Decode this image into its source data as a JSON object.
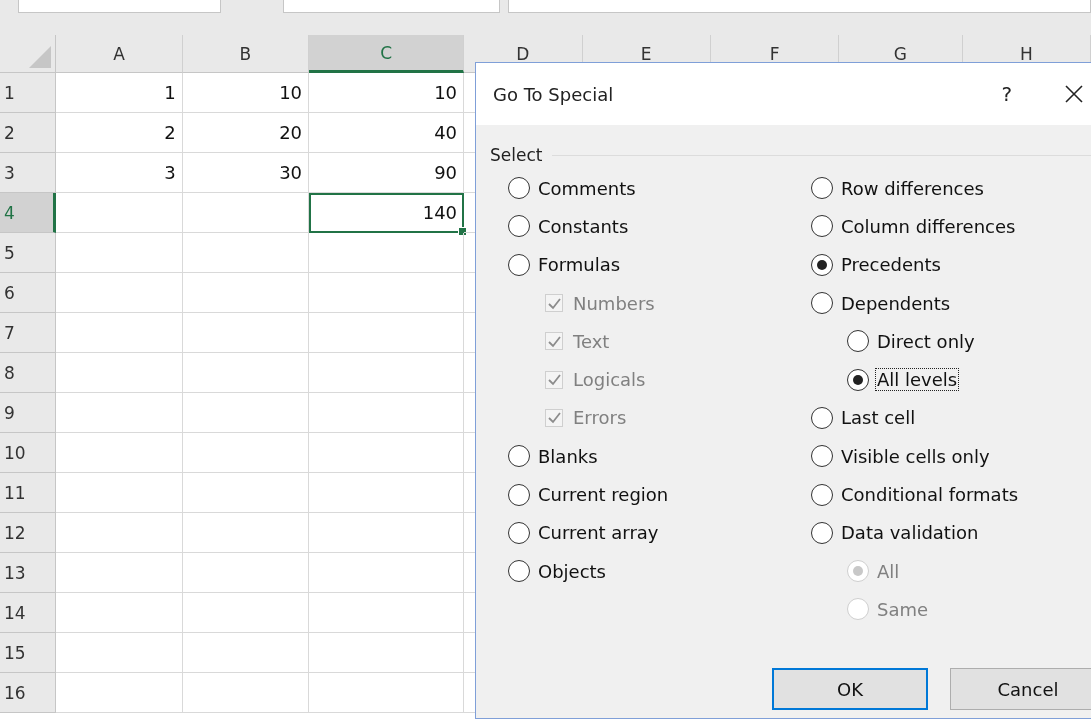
{
  "sheet": {
    "columns": [
      {
        "label": "A",
        "selected": false
      },
      {
        "label": "B",
        "selected": false
      },
      {
        "label": "C",
        "selected": true
      },
      {
        "label": "D",
        "selected": false
      },
      {
        "label": "E",
        "selected": false
      },
      {
        "label": "F",
        "selected": false
      },
      {
        "label": "G",
        "selected": false
      },
      {
        "label": "H",
        "selected": false
      }
    ],
    "rows": [
      {
        "label": "1",
        "selected": false,
        "cells": [
          {
            "value": "1",
            "active": false
          },
          {
            "value": "10",
            "active": false
          },
          {
            "value": "10",
            "active": false
          }
        ]
      },
      {
        "label": "2",
        "selected": false,
        "cells": [
          {
            "value": "2",
            "active": false
          },
          {
            "value": "20",
            "active": false
          },
          {
            "value": "40",
            "active": false
          }
        ]
      },
      {
        "label": "3",
        "selected": false,
        "cells": [
          {
            "value": "3",
            "active": false
          },
          {
            "value": "30",
            "active": false
          },
          {
            "value": "90",
            "active": false
          }
        ]
      },
      {
        "label": "4",
        "selected": true,
        "cells": [
          {
            "active": false
          },
          {
            "active": false
          },
          {
            "value": "140",
            "active": true
          }
        ]
      },
      {
        "label": "5",
        "selected": false
      },
      {
        "label": "6",
        "selected": false
      },
      {
        "label": "7",
        "selected": false
      },
      {
        "label": "8",
        "selected": false
      },
      {
        "label": "9",
        "selected": false
      },
      {
        "label": "10",
        "selected": false
      },
      {
        "label": "11",
        "selected": false
      },
      {
        "label": "12",
        "selected": false
      },
      {
        "label": "13",
        "selected": false
      },
      {
        "label": "14",
        "selected": false
      },
      {
        "label": "15",
        "selected": false
      },
      {
        "label": "16",
        "selected": false
      }
    ]
  },
  "dialog": {
    "title": "Go To Special",
    "help": "?",
    "group_label": "Select",
    "options_left": [
      {
        "kind": "radio",
        "label": "Comments",
        "selected": false,
        "disabled": false,
        "focused": false
      },
      {
        "kind": "radio",
        "label": "Constants",
        "selected": false,
        "disabled": false,
        "focused": false
      },
      {
        "kind": "radio",
        "label": "Formulas",
        "selected": false,
        "disabled": false,
        "focused": false,
        "children": [
          {
            "kind": "checkbox",
            "label": "Numbers",
            "checked": true,
            "disabled": true,
            "focused": false
          },
          {
            "kind": "checkbox",
            "label": "Text",
            "checked": true,
            "disabled": true,
            "focused": false
          },
          {
            "kind": "checkbox",
            "label": "Logicals",
            "checked": true,
            "disabled": true,
            "focused": false
          },
          {
            "kind": "checkbox",
            "label": "Errors",
            "checked": true,
            "disabled": true,
            "focused": false
          }
        ]
      },
      {
        "kind": "radio",
        "label": "Blanks",
        "selected": false,
        "disabled": false,
        "focused": false
      },
      {
        "kind": "radio",
        "label": "Current region",
        "selected": false,
        "disabled": false,
        "focused": false
      },
      {
        "kind": "radio",
        "label": "Current array",
        "selected": false,
        "disabled": false,
        "focused": false
      },
      {
        "kind": "radio",
        "label": "Objects",
        "selected": false,
        "disabled": false,
        "focused": false
      }
    ],
    "options_right": [
      {
        "kind": "radio",
        "label": "Row differences",
        "selected": false,
        "disabled": false,
        "focused": false
      },
      {
        "kind": "radio",
        "label": "Column differences",
        "selected": false,
        "disabled": false,
        "focused": false
      },
      {
        "kind": "radio",
        "label": "Precedents",
        "selected": true,
        "disabled": false,
        "focused": false
      },
      {
        "kind": "radio",
        "label": "Dependents",
        "selected": false,
        "disabled": false,
        "focused": false,
        "children": [
          {
            "kind": "radio",
            "label": "Direct only",
            "selected": false,
            "disabled": false,
            "focused": false
          },
          {
            "kind": "radio",
            "label": "All levels",
            "selected": true,
            "disabled": false,
            "focused": true
          }
        ]
      },
      {
        "kind": "radio",
        "label": "Last cell",
        "selected": false,
        "disabled": false,
        "focused": false
      },
      {
        "kind": "radio",
        "label": "Visible cells only",
        "selected": false,
        "disabled": false,
        "focused": false
      },
      {
        "kind": "radio",
        "label": "Conditional formats",
        "selected": false,
        "disabled": false,
        "focused": false
      },
      {
        "kind": "radio",
        "label": "Data validation",
        "selected": false,
        "disabled": false,
        "focused": false,
        "children": [
          {
            "kind": "radio",
            "label": "All",
            "selected": true,
            "disabled": true,
            "focused": false
          },
          {
            "kind": "radio",
            "label": "Same",
            "selected": false,
            "disabled": true,
            "focused": false
          }
        ]
      }
    ],
    "buttons": [
      {
        "label": "OK",
        "default": true
      },
      {
        "label": "Cancel",
        "default": false
      }
    ]
  }
}
